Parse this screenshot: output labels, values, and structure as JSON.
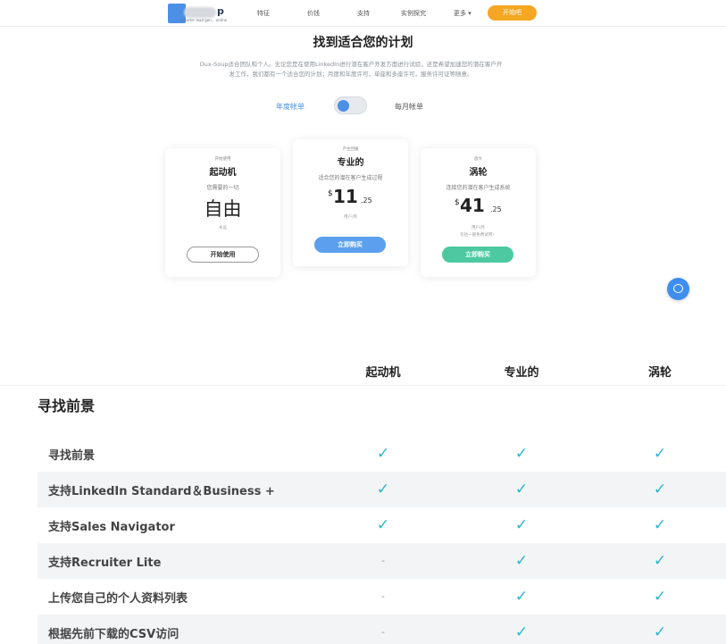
{
  "nav": {
    "logo_letter": "p",
    "logo_tagline": "Smarter lead gen... online",
    "links": [
      "特征",
      "价钱",
      "支持",
      "实例探究"
    ],
    "more": "更多",
    "cta": "开始吧"
  },
  "hero": {
    "title": "找到适合您的计划",
    "desc_line1": "Dux-Soup适合团队和个人。无论您是在使用LinkedIn进行潜在客户开发方面进行试验，还是希望加速您的潜在客户开",
    "desc_line2": "发工作，我们都有一个适合您的计划；月度和年度许可，单座和多座许可，服务许可证等随意。"
  },
  "billing": {
    "left": "年度帐单",
    "right": "每月帐单"
  },
  "plans": [
    {
      "tag": "开始使用",
      "name": "起动机",
      "desc": "您需要的一切",
      "free": "自由",
      "note": "永远",
      "button": "开始使用"
    },
    {
      "tag": "产生回报",
      "name": "专业的",
      "desc": "适合您的潜在客户生成过程",
      "currency": "$",
      "price": "11",
      "cents": ".25",
      "note": "用户/月",
      "button": "立即购买"
    },
    {
      "tag": "放大",
      "name": "涡轮",
      "desc": "连接您的潜在客户生成系统",
      "currency": "$",
      "price": "41",
      "cents": ".25",
      "note": "用户/月",
      "note2": "包括一部免费试用）",
      "button": "立即购买"
    }
  ],
  "table": {
    "headers": [
      "起动机",
      "专业的",
      "涡轮"
    ],
    "section": "寻找前景",
    "rows": [
      {
        "label": "寻找前景",
        "cells": [
          "✓",
          "✓",
          "✓"
        ]
      },
      {
        "label": "支持LinkedIn Standard＆Business +",
        "cells": [
          "✓",
          "✓",
          "✓"
        ]
      },
      {
        "label": "支持Sales Navigator",
        "cells": [
          "✓",
          "✓",
          "✓"
        ]
      },
      {
        "label": "支持Recruiter Lite",
        "cells": [
          "-",
          "✓",
          "✓"
        ]
      },
      {
        "label": "上传您自己的个人资料列表",
        "cells": [
          "-",
          "✓",
          "✓"
        ]
      },
      {
        "label": "根据先前下载的CSV访问",
        "cells": [
          "-",
          "✓",
          "✓"
        ]
      }
    ]
  },
  "colors": {
    "accent_blue": "#4b8fe6",
    "cta_orange": "#f5a623",
    "green": "#4cc9a0",
    "check": "#2bb5cf"
  }
}
